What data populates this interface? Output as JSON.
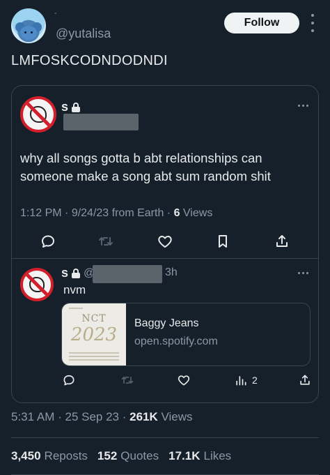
{
  "header": {
    "handle": "@yutalisa",
    "name_fragment": "-",
    "follow_label": "Follow"
  },
  "main_tweet": {
    "text": "LMFOSKCODNDODNDI"
  },
  "quoted_tweet": {
    "author_initial": "s",
    "text": "why all songs gotta b abt relationships can someone make a song abt sum random shit",
    "time": "1:12 PM",
    "date": "9/24/23",
    "source": "from Earth",
    "views_count": "6",
    "views_label": "Views"
  },
  "reply": {
    "author_initial": "s",
    "at": "@",
    "age": "3h",
    "text": "nvm",
    "link_card": {
      "title": "Baggy Jeans",
      "domain": "open.spotify.com",
      "album_text": "NCT",
      "album_year": "2023"
    },
    "analytics_count": "2"
  },
  "footer": {
    "time": "5:31 AM",
    "date": "25 Sep 23",
    "views_count": "261K",
    "views_label": "Views",
    "reposts_count": "3,450",
    "reposts_label": "Reposts",
    "quotes_count": "152",
    "quotes_label": "Quotes",
    "likes_count": "17.1K",
    "likes_label": "Likes"
  },
  "colors": {
    "background": "#15202b",
    "text": "#e7e9ea",
    "muted": "#8b98a5",
    "border": "#38444d",
    "follow_bg": "#eff3f4"
  }
}
